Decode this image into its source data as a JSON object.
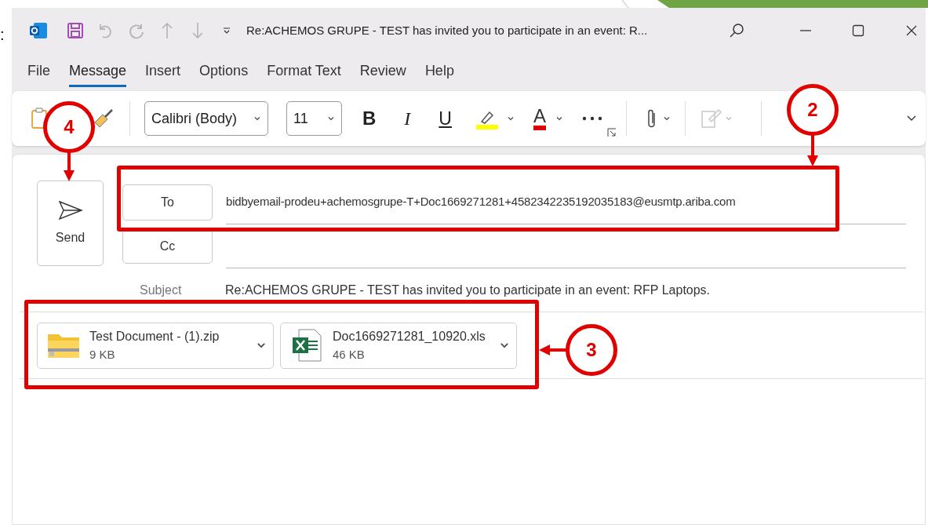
{
  "edge_text": ":",
  "title_bar": {
    "title": "Re:ACHEMOS GRUPE - TEST has invited you to participate in an event: R..."
  },
  "menu_tabs": [
    {
      "label": "File",
      "selected": false
    },
    {
      "label": "Message",
      "selected": true
    },
    {
      "label": "Insert",
      "selected": false
    },
    {
      "label": "Options",
      "selected": false
    },
    {
      "label": "Format Text",
      "selected": false
    },
    {
      "label": "Review",
      "selected": false
    },
    {
      "label": "Help",
      "selected": false
    }
  ],
  "ribbon": {
    "font": "Calibri (Body)",
    "font_size": "11",
    "bold": "B",
    "italic": "I",
    "underline": "U",
    "color_tools": [
      {
        "kind": "highlight",
        "color": "#ffff00"
      },
      {
        "kind": "font_color",
        "label": "A",
        "color": "#e00000"
      }
    ],
    "signature_disabled": true
  },
  "compose": {
    "send": "Send",
    "to_label": "To",
    "to_value": "bidbyemail-prodeu+achemosgrupe-T+Doc1669271281+4582342235192035183@eusmtp.ariba.com",
    "cc_label": "Cc",
    "subject_label": "Subject",
    "subject_value": "Re:ACHEMOS GRUPE - TEST has invited you to participate in an event: RFP Laptops."
  },
  "attachments": [
    {
      "name": "Test Document - (1).zip",
      "size": "9 KB",
      "kind": "zip"
    },
    {
      "name": "Doc1669271281_10920.xls",
      "size": "46 KB",
      "kind": "excel"
    }
  ],
  "callouts": [
    {
      "label": "4"
    },
    {
      "label": "2"
    },
    {
      "label": "3"
    }
  ]
}
